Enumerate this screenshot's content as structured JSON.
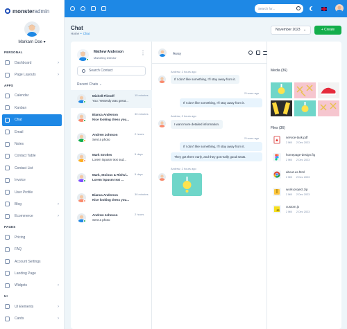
{
  "app": {
    "logo_bold": "monster",
    "logo_light": "admin"
  },
  "user": {
    "name": "Markarn Doe"
  },
  "header": {
    "search_placeholder": "Search for..."
  },
  "sidebar": {
    "sections": [
      {
        "title": "PERSONAL",
        "items": [
          {
            "label": "Dashboard",
            "chevron": true
          },
          {
            "label": "Page Layouts",
            "chevron": true
          }
        ]
      },
      {
        "title": "APPS",
        "items": [
          {
            "label": "Calendar",
            "chevron": false
          },
          {
            "label": "Kanban",
            "chevron": false
          },
          {
            "label": "Chat",
            "chevron": false,
            "active": true
          },
          {
            "label": "Email",
            "chevron": false
          },
          {
            "label": "Notes",
            "chevron": false
          },
          {
            "label": "Contact Table",
            "chevron": false
          },
          {
            "label": "Contact List",
            "chevron": false
          },
          {
            "label": "Invoice",
            "chevron": false
          },
          {
            "label": "User Profile",
            "chevron": false
          },
          {
            "label": "Blog",
            "chevron": true
          },
          {
            "label": "Ecommerce",
            "chevron": true
          }
        ]
      },
      {
        "title": "PAGES",
        "items": [
          {
            "label": "Pricing",
            "chevron": false
          },
          {
            "label": "FAQ",
            "chevron": false
          },
          {
            "label": "Account Settings",
            "chevron": false
          },
          {
            "label": "Landing Page",
            "chevron": false
          },
          {
            "label": "Widgets",
            "chevron": true
          }
        ]
      },
      {
        "title": "UI",
        "items": [
          {
            "label": "UI Elements",
            "chevron": true
          },
          {
            "label": "Cards",
            "chevron": true
          }
        ]
      }
    ]
  },
  "page": {
    "title": "Chat",
    "breadcrumb_home": "Home",
    "breadcrumb_sep": "•",
    "breadcrumb_current": "Chat",
    "month_button": "November 2023",
    "create_button": "+ Create"
  },
  "contacts": {
    "me_name": "Mathew Anderson",
    "me_role": "Marketing Director",
    "search_placeholder": "Search Contact",
    "recent_label": "Recent Chats",
    "items": [
      {
        "name": "Michell Flintoff",
        "msg": "You: Yesterdy was great...",
        "time": "15 minutes",
        "status": "online",
        "bold": false
      },
      {
        "name": "Bianca Anderson",
        "msg": "Nice looking dress you...",
        "time": "30 minutes",
        "status": "online",
        "bold": true
      },
      {
        "name": "Andrew Johnson",
        "msg": "Sent a photo",
        "time": "2 hours",
        "status": "away",
        "bold": false
      },
      {
        "name": "Mark Strokes",
        "msg": "Lorem ispusm text sud...",
        "time": "5 days",
        "status": "busy",
        "bold": false
      },
      {
        "name": "Mark, Stoinus & Rishvi..",
        "msg": "Lorem ispusm text ...",
        "time": "5 days",
        "status": "online",
        "bold": true
      },
      {
        "name": "Bianca Anderson",
        "msg": "Nice looking dress you...",
        "time": "30 minutes",
        "status": "busy",
        "bold": true
      },
      {
        "name": "Andrew Johnson",
        "msg": "Sent a photo",
        "time": "2 hours",
        "status": "online",
        "bold": false
      }
    ]
  },
  "conversation": {
    "status": "Away",
    "messages": [
      {
        "meta": "Andrew, 2 hours ago",
        "text": "If I don't like something, I'll stay away from it."
      },
      {
        "meta": "2 hours ago",
        "text": "If I don't like something, I'll stay away from it."
      },
      {
        "meta": "Andrew, 2 hours ago",
        "text": "I want more detailed information."
      },
      {
        "meta": "2 hours ago",
        "text": "If I don't like something, I'll stay away from it."
      },
      {
        "meta": "",
        "text": "They got there early, and they got really good seats."
      },
      {
        "meta": "Andrew, 2 hours ago",
        "text": ""
      }
    ]
  },
  "media": {
    "label": "Media (36)"
  },
  "files": {
    "label": "Files (36)",
    "items": [
      {
        "name": "service-task.pdf",
        "size": "2 MB",
        "date": "2 Dec 2023",
        "icon": "pdf-icon"
      },
      {
        "name": "homepage-design.fig",
        "size": "2 MB",
        "date": "2 Dec 2023",
        "icon": "figma-icon"
      },
      {
        "name": "about-us.html",
        "size": "2 MB",
        "date": "2 Dec 2023",
        "icon": "chrome-icon"
      },
      {
        "name": "work-project.zip",
        "size": "2 MB",
        "date": "2 Dec 2023",
        "icon": "zip-icon"
      },
      {
        "name": "custom.js",
        "size": "2 MB",
        "date": "2 Dec 2023",
        "icon": "js-icon"
      }
    ]
  },
  "colors": {
    "primary": "#1e88e5",
    "create": "#13ae4b",
    "online": "#13ae4b",
    "away": "#ffae1f",
    "busy": "#fa896b"
  }
}
